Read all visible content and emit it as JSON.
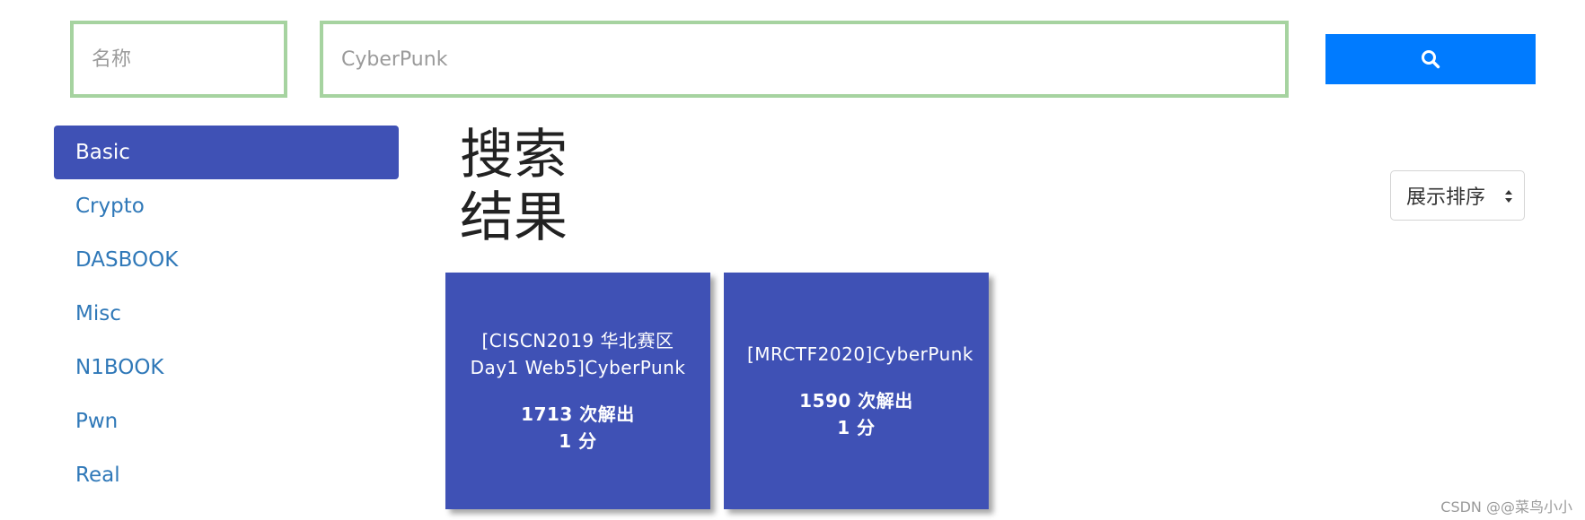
{
  "search": {
    "name_placeholder": "名称",
    "query_value": "CyberPunk",
    "button_icon": "search-icon"
  },
  "sidebar": {
    "items": [
      {
        "label": "Basic",
        "active": true
      },
      {
        "label": "Crypto",
        "active": false
      },
      {
        "label": "DASBOOK",
        "active": false
      },
      {
        "label": "Misc",
        "active": false
      },
      {
        "label": "N1BOOK",
        "active": false
      },
      {
        "label": "Pwn",
        "active": false
      },
      {
        "label": "Real",
        "active": false
      }
    ]
  },
  "main": {
    "heading": "搜索结果",
    "sort_label": "展示排序",
    "cards": [
      {
        "title": "[CISCN2019 华北赛区 Day1 Web5]CyberPunk",
        "solves": "1713 次解出",
        "score": "1 分"
      },
      {
        "title": "[MRCTF2020]CyberPunk",
        "solves": "1590 次解出",
        "score": "1 分"
      }
    ]
  },
  "watermark": "CSDN @@菜鸟小小",
  "colors": {
    "accent": "#3f51b5",
    "search_button": "#007bff",
    "field_border": "#a6d3a0",
    "link": "#2f78b8"
  }
}
